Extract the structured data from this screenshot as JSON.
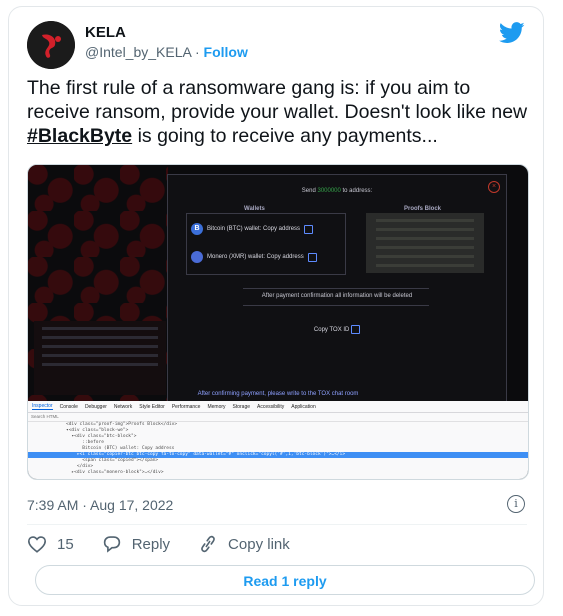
{
  "author": {
    "name": "KELA",
    "handle": "@Intel_by_KELA",
    "separator": " · ",
    "follow_label": "Follow"
  },
  "tweet": {
    "text_before": "The first rule of a ransomware gang is: if you aim to receive ransom, provide your wallet. Doesn't look like new ",
    "hashtag": "#BlackByte",
    "text_after": " is going to receive any payments..."
  },
  "media": {
    "send_text_prefix": "Send",
    "send_amount": "3000000",
    "send_text_suffix": "to address:",
    "wallets_heading": "Wallets",
    "proofs_heading": "Proofs Block",
    "btc_icon": "B",
    "btc_label": "Bitcoin (BTC) wallet: Copy address",
    "xmr_label": "Monero (XMR) wallet: Copy address",
    "payment_info": "After payment confirmation all information will be deleted",
    "tox_label": "Copy TOX ID",
    "confirm_msg": "After confirming payment, please write to the TOX chat room",
    "devtools_tabs": [
      "Inspector",
      "Console",
      "Debugger",
      "Network",
      "Style Editor",
      "Performance",
      "Memory",
      "Storage",
      "Accessibility",
      "Application"
    ],
    "devtools_search": "Search HTML",
    "code_lines": [
      "<div class=\"proof-img\">Proofs Block</div>",
      "▾<div class=\"block-we\">",
      "  ▾<div class=\"btc-block\">",
      "      ::before",
      "      Bitcoin (BTC) wallet: Copy address",
      "    ▸<i class=\"copier-btc btc-copy fa-to-copy\" data-wallet=\"#\" onclick=\"copyl('#',1,'btc-block')\">…</i>",
      "      <span class=\"copied\"></span>",
      "    </div>",
      "  ▸<div class=\"monero-block\">…</div>"
    ]
  },
  "meta": {
    "timestamp": "7:39 AM · Aug 17, 2022"
  },
  "actions": {
    "likes": "15",
    "reply_label": "Reply",
    "copy_link_label": "Copy link"
  },
  "read_reply_label": "Read 1 reply",
  "colors": {
    "accent": "#1d9bf0",
    "text": "#0f1419",
    "muted": "#536471"
  }
}
